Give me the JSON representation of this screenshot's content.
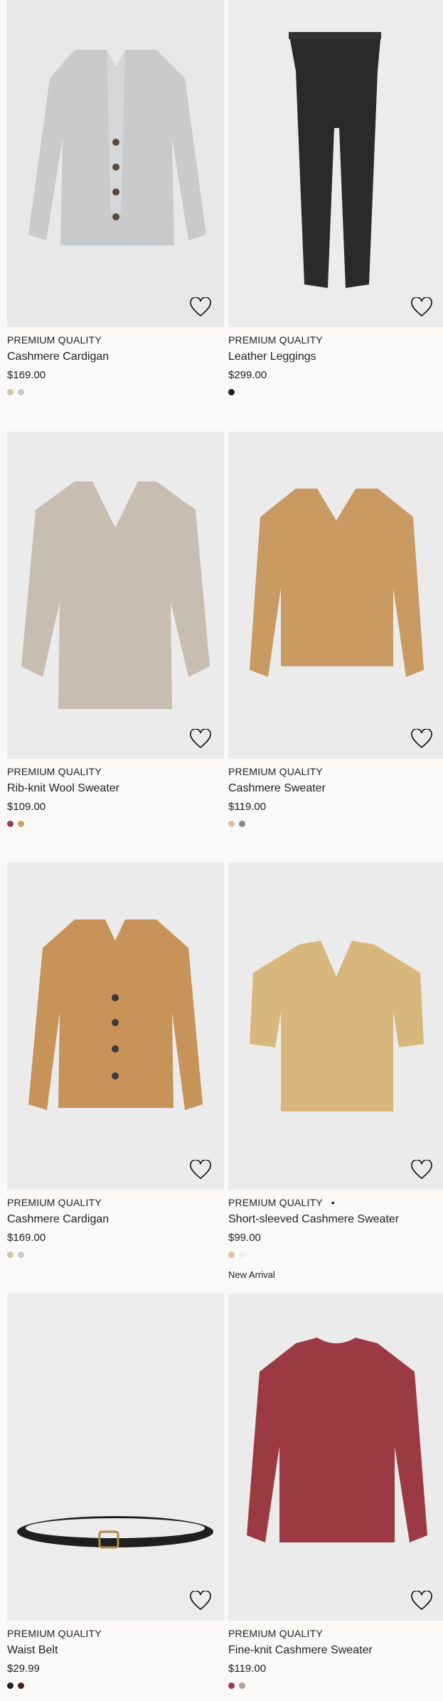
{
  "products": [
    {
      "label": "PREMIUM QUALITY",
      "title": "Cashmere Cardigan",
      "price": "$169.00",
      "swatches": [
        "#d4c4a4",
        "#c9c9c9"
      ],
      "bg": "#e8e8e8"
    },
    {
      "label": "PREMIUM QUALITY",
      "title": "Leather Leggings",
      "price": "$299.00",
      "swatches": [
        "#1e1e1e"
      ],
      "bg": "#ececec"
    },
    {
      "label": "PREMIUM QUALITY",
      "title": "Rib-knit Wool Sweater",
      "price": "$109.00",
      "swatches": [
        "#9b3b4e",
        "#c8a26a"
      ],
      "bg": "#ebebeb"
    },
    {
      "label": "PREMIUM QUALITY",
      "title": "Cashmere Sweater",
      "price": "$119.00",
      "swatches": [
        "#d9c3a1",
        "#8a8a8a"
      ],
      "bg": "#ebebeb"
    },
    {
      "label": "PREMIUM QUALITY",
      "title": "Cashmere Cardigan",
      "price": "$169.00",
      "swatches": [
        "#d4c4a4",
        "#c9c9c9"
      ],
      "bg": "#ebebeb"
    },
    {
      "label": "PREMIUM QUALITY",
      "title": "Short-sleeved Cashmere Sweater",
      "price": "$99.00",
      "swatches": [
        "#dcc4a2",
        "#efefef"
      ],
      "extra": "•",
      "new": "New Arrival",
      "bg": "#ebebeb"
    },
    {
      "label": "PREMIUM QUALITY",
      "title": "Waist Belt",
      "price": "$29.99",
      "swatches": [
        "#222222",
        "#4a2020"
      ],
      "bg": "#ececec"
    },
    {
      "label": "PREMIUM QUALITY",
      "title": "Fine-knit Cashmere Sweater",
      "price": "$119.00",
      "swatches": [
        "#9b3b4e",
        "#b59a9a"
      ],
      "bg": "#ebebeb"
    }
  ]
}
